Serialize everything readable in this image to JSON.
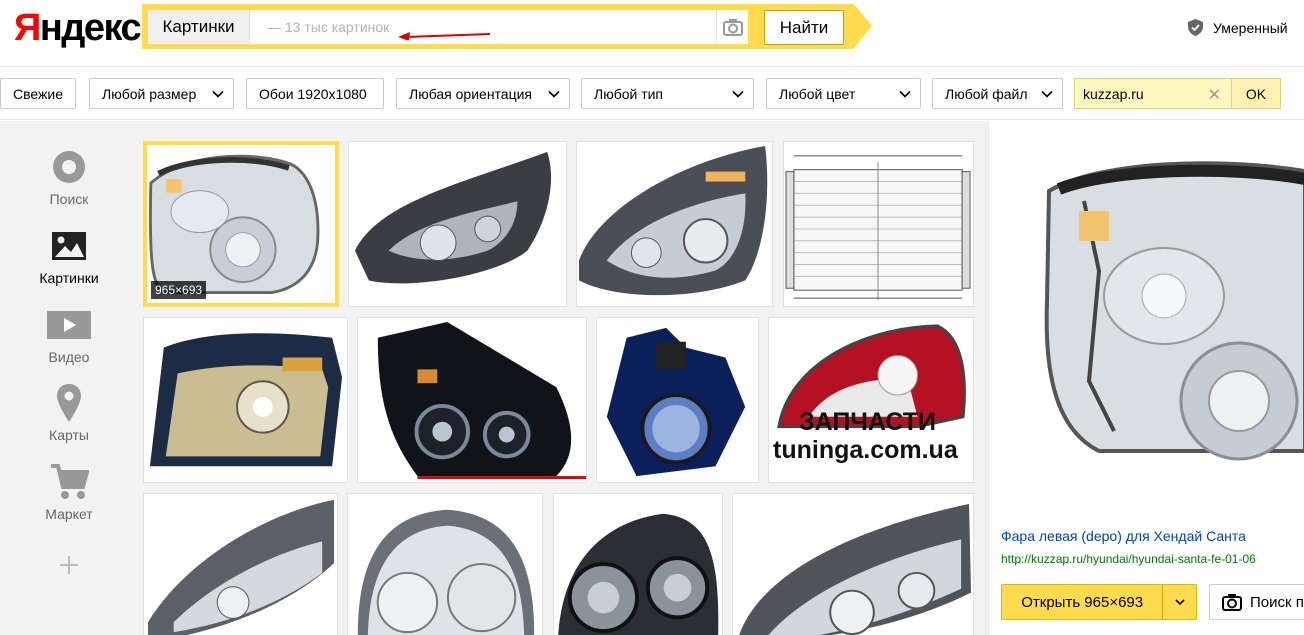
{
  "header": {
    "logo": "Яндекс",
    "logo_first": "Я",
    "logo_rest": "ндекс",
    "search_tab": "Картинки",
    "search_placeholder": "— 13 тыс картинок",
    "search_button": "Найти",
    "family_filter": "Умеренный"
  },
  "filters": {
    "fresh": "Свежие",
    "size": "Любой размер",
    "wallpaper": "Обои 1920x1080",
    "orientation": "Любая ориентация",
    "type": "Любой тип",
    "color": "Любой цвет",
    "file": "Любой файл",
    "site": "kuzzap.ru",
    "ok": "OK"
  },
  "sidebar": {
    "items": [
      {
        "label": "Поиск",
        "icon": "search-circle-icon"
      },
      {
        "label": "Картинки",
        "icon": "image-icon"
      },
      {
        "label": "Видео",
        "icon": "video-play-icon"
      },
      {
        "label": "Карты",
        "icon": "map-pin-icon"
      },
      {
        "label": "Маркет",
        "icon": "cart-icon"
      },
      {
        "label": "",
        "icon": "plus-icon"
      }
    ]
  },
  "grid": {
    "selected_size": "965×693",
    "watermark_line1": "ЗАПЧАСТИ",
    "watermark_line2": "tuninga.com.ua"
  },
  "preview": {
    "title": "Фара левая (depo) для Хендай Санта",
    "url": "http://kuzzap.ru/hyundai/hyundai-santa-fe-01-06",
    "open_button": "Открыть 965×693",
    "similar_button": "Поиск п"
  },
  "colors": {
    "yandex_yellow": "#ffdb4d",
    "logo_red": "#ff0000",
    "link_blue": "#0044bb",
    "url_green": "#007700"
  }
}
